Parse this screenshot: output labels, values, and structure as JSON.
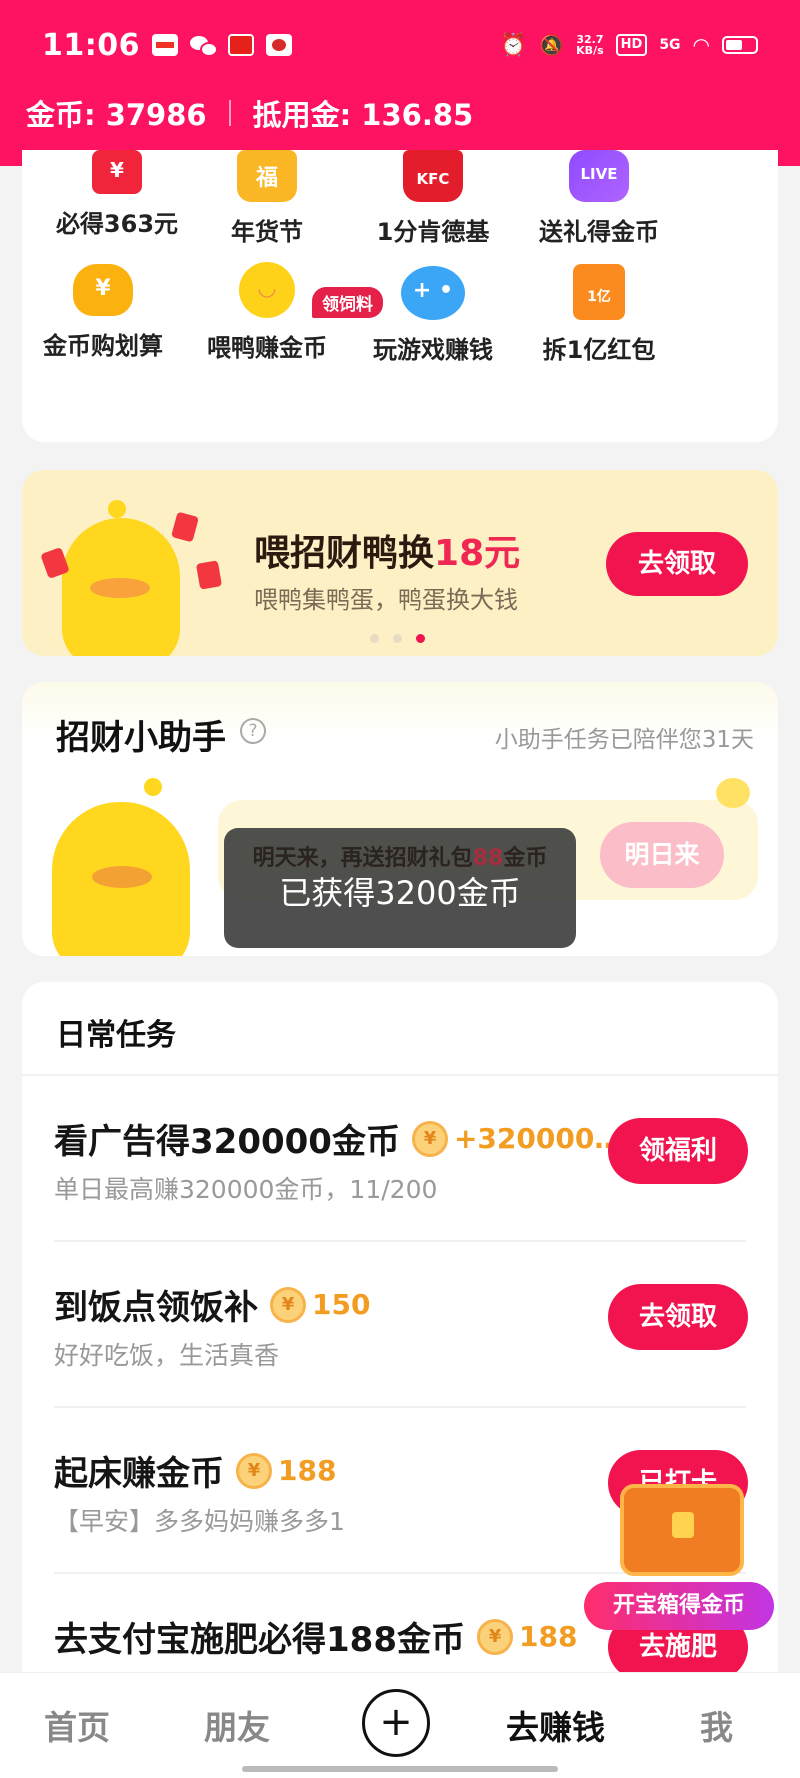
{
  "status_bar": {
    "time": "11:06",
    "net_speed_value": "32.7",
    "net_speed_unit": "KB/s",
    "hd": "HD",
    "network": "5G"
  },
  "balance": {
    "coins": "金币: 37986",
    "deduct": "抵用金: 136.85"
  },
  "quick_items": [
    {
      "label": "必得363元",
      "icon": "red-envelope-icon"
    },
    {
      "label": "年货节",
      "icon": "shopping-cart-icon"
    },
    {
      "label": "1分肯德基",
      "icon": "kfc-fries-icon"
    },
    {
      "label": "送礼得金币",
      "icon": "live-icon"
    },
    {
      "label": "金币购划算",
      "icon": "money-bag-icon"
    },
    {
      "label": "喂鸭赚金币",
      "icon": "duck-icon"
    },
    {
      "label": "玩游戏赚钱",
      "icon": "game-controller-icon"
    },
    {
      "label": "拆1亿红包",
      "icon": "red-packet-icon"
    }
  ],
  "feed_tag": "领饲料",
  "banner": {
    "title_prefix": "喂招财鸭换",
    "title_highlight": "18元",
    "subtitle": "喂鸭集鸭蛋，鸭蛋换大钱",
    "button": "去领取"
  },
  "assistant": {
    "title": "招财小助手",
    "help": "?",
    "days": "小助手任务已陪伴您31天",
    "button": "明日来"
  },
  "toast": {
    "line1_prefix": "明天来，再送招财礼包",
    "line1_number": "88",
    "line1_suffix": "金币",
    "line2": "已获得3200金币"
  },
  "tasks": {
    "title": "日常任务",
    "items": [
      {
        "name": "看广告得320000金币",
        "reward": "+320000…",
        "desc": "单日最高赚320000金币，11/200",
        "button": "领福利"
      },
      {
        "name": "到饭点领饭补",
        "reward": "150",
        "desc": "好好吃饭，生活真香",
        "button": "去领取"
      },
      {
        "name": "起床赚金币",
        "reward": "188",
        "desc": "【早安】多多妈妈赚多多1",
        "button": "已打卡"
      },
      {
        "name": "去支付宝施肥必得188金币",
        "reward": "188",
        "desc": "",
        "button": "去施肥"
      }
    ]
  },
  "treasure": {
    "label": "开宝箱得金币"
  },
  "nav": {
    "home": "首页",
    "friends": "朋友",
    "plus": "+",
    "earn": "去赚钱",
    "me": "我"
  }
}
